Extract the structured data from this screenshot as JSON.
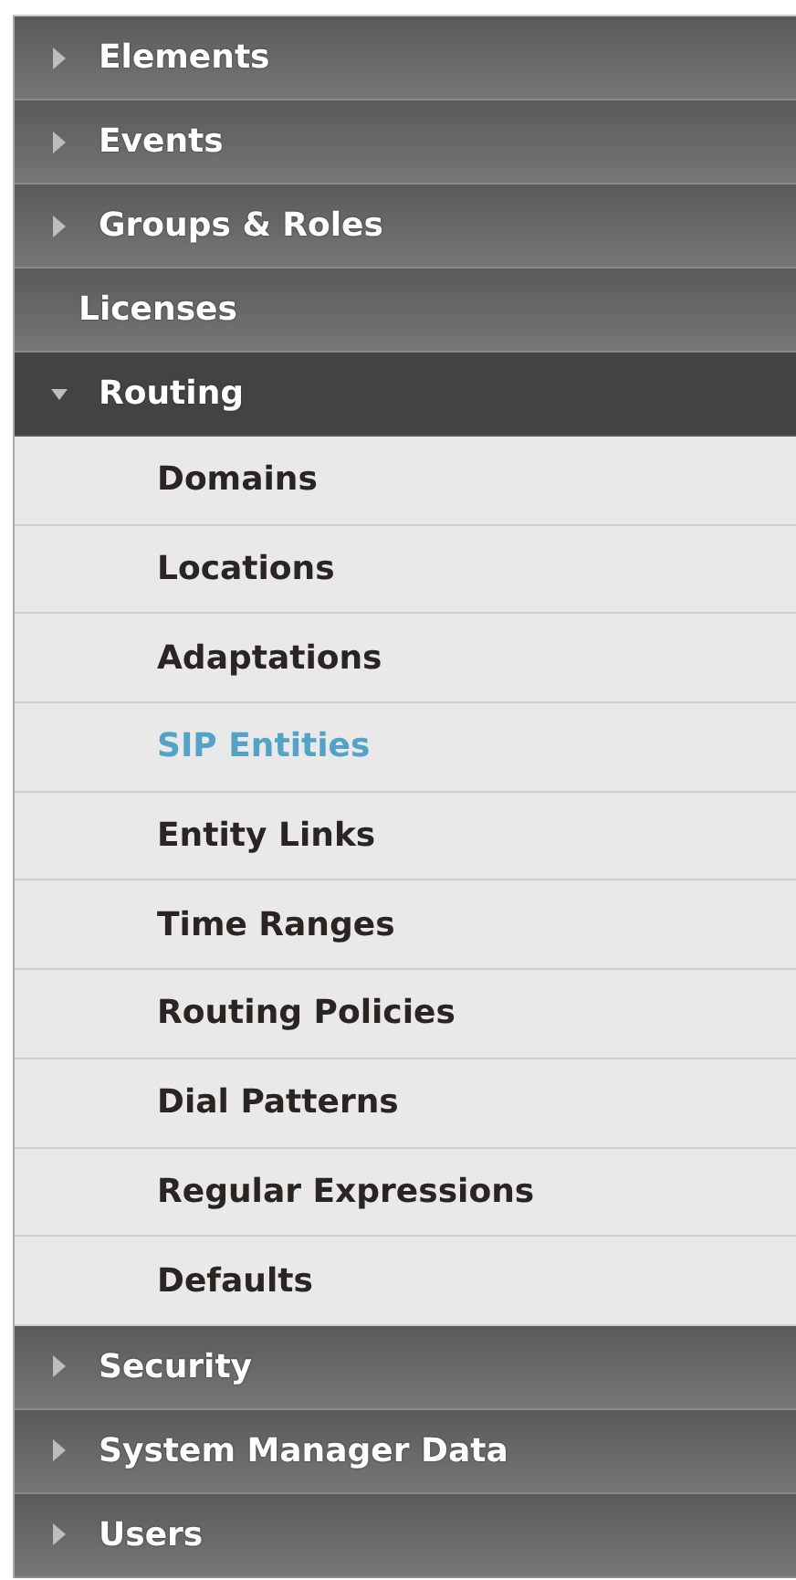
{
  "nav": {
    "items": [
      {
        "label": "Elements",
        "kind": "group",
        "expanded": false
      },
      {
        "label": "Events",
        "kind": "group",
        "expanded": false
      },
      {
        "label": "Groups & Roles",
        "kind": "group",
        "expanded": false
      },
      {
        "label": "Licenses",
        "kind": "link"
      },
      {
        "label": "Routing",
        "kind": "group",
        "expanded": true,
        "children": [
          {
            "label": "Domains",
            "selected": false
          },
          {
            "label": "Locations",
            "selected": false
          },
          {
            "label": "Adaptations",
            "selected": false
          },
          {
            "label": "SIP Entities",
            "selected": true
          },
          {
            "label": "Entity Links",
            "selected": false
          },
          {
            "label": "Time Ranges",
            "selected": false
          },
          {
            "label": "Routing Policies",
            "selected": false
          },
          {
            "label": "Dial Patterns",
            "selected": false
          },
          {
            "label": "Regular Expressions",
            "selected": false
          },
          {
            "label": "Defaults",
            "selected": false
          }
        ]
      },
      {
        "label": "Security",
        "kind": "group",
        "expanded": false
      },
      {
        "label": "System Manager Data",
        "kind": "group",
        "expanded": false
      },
      {
        "label": "Users",
        "kind": "group",
        "expanded": false
      }
    ]
  }
}
